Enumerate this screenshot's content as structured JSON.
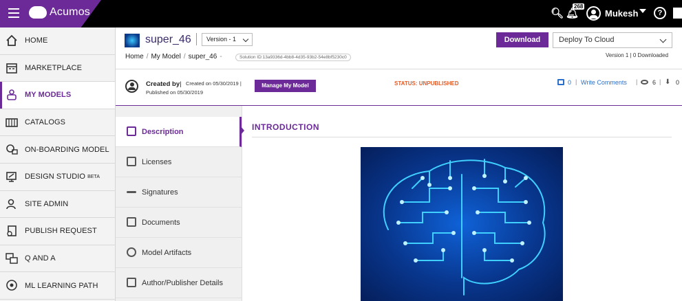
{
  "app": {
    "brand": "Acumos"
  },
  "topbar": {
    "notification_count": "268",
    "user_name": "Mukesh"
  },
  "sidebar": {
    "items": [
      {
        "label": "HOME",
        "icon": "home-icon"
      },
      {
        "label": "MARKETPLACE",
        "icon": "store-icon"
      },
      {
        "label": "MY MODELS",
        "icon": "robot-icon"
      },
      {
        "label": "CATALOGS",
        "icon": "catalog-icon"
      },
      {
        "label": "ON-BOARDING MODEL",
        "icon": "onboarding-icon"
      },
      {
        "label": "DESIGN STUDIO",
        "icon": "design-studio-icon",
        "badge": "BETA"
      },
      {
        "label": "SITE ADMIN",
        "icon": "admin-icon"
      },
      {
        "label": "PUBLISH REQUEST",
        "icon": "publish-request-icon"
      },
      {
        "label": "Q AND A",
        "icon": "qa-icon"
      },
      {
        "label": "ML LEARNING PATH",
        "icon": "learning-path-icon"
      }
    ],
    "active_index": 2
  },
  "header": {
    "model_name": "super_46",
    "version_label": "Version - 1",
    "breadcrumb": [
      "Home",
      "My Model",
      "super_46"
    ],
    "breadcrumb_tail_sep": "-",
    "solution_id": "Solution ID:13a9336d-4bb8-4d35-93b2-54e8bf5230c0",
    "download_label": "Download",
    "deploy_label": "Deploy To Cloud",
    "version_info": "Version 1 | 0 Downloaded"
  },
  "meta": {
    "created_by_label": "Created by",
    "created_on": "Created on 05/30/2019",
    "published_on": "Published on 05/30/2019",
    "manage_label": "Manage My Model",
    "status": "STATUS: UNPUBLISHED",
    "comment_count": "0",
    "write_comments": "Write Comments",
    "view_count": "6",
    "download_count": "0"
  },
  "tabs": {
    "items": [
      {
        "label": "Description",
        "icon": "description-icon"
      },
      {
        "label": "Licenses",
        "icon": "license-icon"
      },
      {
        "label": "Signatures",
        "icon": "signature-icon"
      },
      {
        "label": "Documents",
        "icon": "documents-icon"
      },
      {
        "label": "Model Artifacts",
        "icon": "history-icon"
      },
      {
        "label": "Author/Publisher Details",
        "icon": "author-icon"
      }
    ],
    "active_index": 0
  },
  "content": {
    "section_title": "INTRODUCTION"
  },
  "colors": {
    "brand_purple": "#6b2a98",
    "status_orange": "#e25b27",
    "link_blue": "#2a6fc9",
    "topbar": "#000000"
  }
}
